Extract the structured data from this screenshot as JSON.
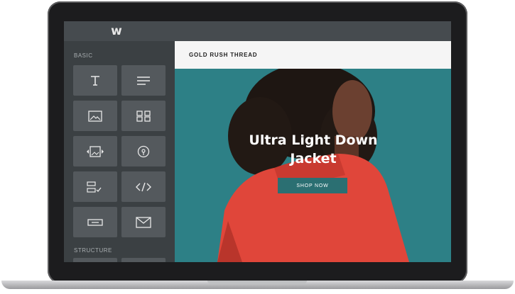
{
  "editor": {
    "logo": "w",
    "sections": {
      "basic": "BASIC",
      "structure": "STRUCTURE"
    },
    "tiles": [
      {
        "icon": "text-icon"
      },
      {
        "icon": "paragraph-icon"
      },
      {
        "icon": "image-icon"
      },
      {
        "icon": "gallery-icon"
      },
      {
        "icon": "slideshow-icon"
      },
      {
        "icon": "map-pin-icon"
      },
      {
        "icon": "form-icon"
      },
      {
        "icon": "embed-code-icon"
      },
      {
        "icon": "button-icon"
      },
      {
        "icon": "email-icon"
      }
    ]
  },
  "site": {
    "title": "GOLD RUSH THREAD",
    "hero": {
      "headline": "Ultra Light Down Jacket",
      "cta": "SHOP NOW"
    }
  },
  "colors": {
    "accent": "#2f8389",
    "button": "#2b6f72",
    "jacket": "#e0463a"
  }
}
